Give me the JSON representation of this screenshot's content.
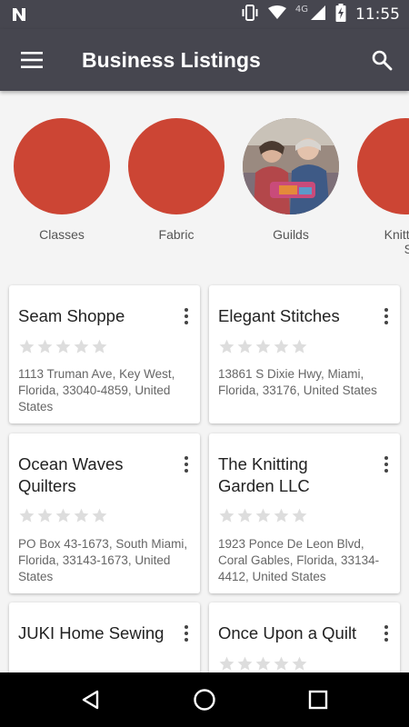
{
  "status_bar": {
    "network": "4G",
    "time": "11:55",
    "icons": [
      "notification-n-icon",
      "vibrate-icon",
      "wifi-icon",
      "signal-icon",
      "battery-charging-icon"
    ]
  },
  "app_bar": {
    "title": "Business Listings",
    "menu_icon": "hamburger-menu-icon",
    "search_icon": "search-icon"
  },
  "colors": {
    "app_bar": "#46464f",
    "accent": "#cc4534",
    "background": "#f4f4f4",
    "star_empty": "#dddddd"
  },
  "categories": [
    {
      "label": "Classes"
    },
    {
      "label": "Fabric"
    },
    {
      "label": "Guilds"
    },
    {
      "label_line1": "Knitting",
      "label_line2": "Supp"
    }
  ],
  "listings": [
    {
      "name": "Seam Shoppe",
      "address": "1113 Truman Ave, Key West, Florida, 33040-4859, United States",
      "rating": 0
    },
    {
      "name": "Elegant Stitches",
      "address": "13861 S Dixie Hwy, Miami, Florida, 33176, United States",
      "rating": 0
    },
    {
      "name": "Ocean Waves Quilters",
      "address": "PO Box 43-1673, South Miami, Florida, 33143-1673, United States",
      "rating": 0
    },
    {
      "name": "The Knitting Garden LLC",
      "address": "1923 Ponce De Leon Blvd, Coral Gables, Florida, 33134-4412, United States",
      "rating": 0
    },
    {
      "name": "JUKI Home Sewing",
      "address": "",
      "rating": 0
    },
    {
      "name": "Once Upon a Quilt",
      "address": "",
      "rating": 0
    }
  ],
  "nav_bar": {
    "back_icon": "back-triangle-icon",
    "home_icon": "home-circle-icon",
    "recents_icon": "recents-square-icon"
  }
}
